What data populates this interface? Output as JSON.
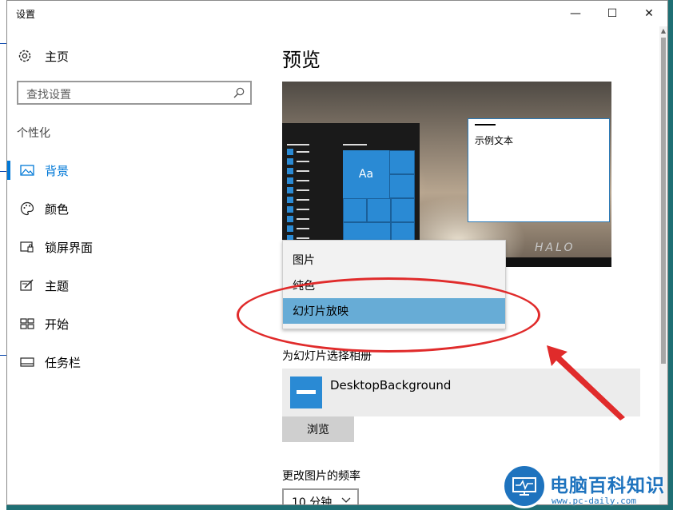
{
  "window": {
    "title": "设置",
    "controls": {
      "minimize": "—",
      "maximize": "☐",
      "close": "✕"
    }
  },
  "sidebar": {
    "home_label": "主页",
    "search_placeholder": "查找设置",
    "section_title": "个性化",
    "items": [
      {
        "label": "背景",
        "icon": "image-icon",
        "active": true
      },
      {
        "label": "颜色",
        "icon": "palette-icon",
        "active": false
      },
      {
        "label": "锁屏界面",
        "icon": "lock-screen-icon",
        "active": false
      },
      {
        "label": "主题",
        "icon": "theme-icon",
        "active": false
      },
      {
        "label": "开始",
        "icon": "start-icon",
        "active": false
      },
      {
        "label": "任务栏",
        "icon": "taskbar-icon",
        "active": false
      }
    ]
  },
  "main": {
    "preview_heading": "预览",
    "preview": {
      "tile_text": "Aa",
      "sample_text": "示例文本",
      "wallpaper_logo": "HALO"
    },
    "background_dropdown": {
      "options": [
        "图片",
        "纯色",
        "幻灯片放映"
      ],
      "selected": "幻灯片放映"
    },
    "album_label": "为幻灯片选择相册",
    "album_name": "DesktopBackground",
    "browse_label": "浏览",
    "frequency_label": "更改图片的频率",
    "frequency_value": "10 分钟"
  },
  "watermark": {
    "name": "电脑百科知识",
    "url": "www.pc-daily.com"
  },
  "colors": {
    "accent": "#0078d7",
    "selection": "#67acd6",
    "annotation": "#e02b2b"
  }
}
